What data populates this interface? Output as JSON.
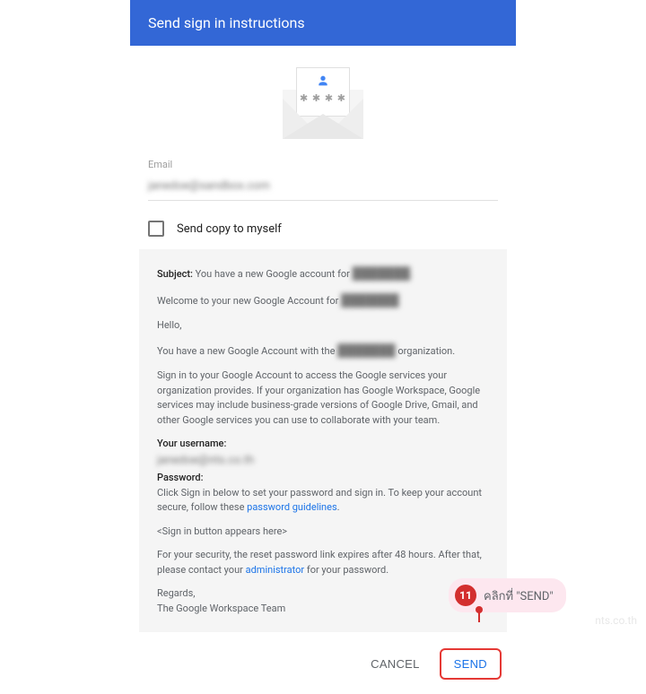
{
  "header": {
    "title": "Send sign in instructions"
  },
  "email": {
    "label": "Email",
    "value": "janedoe@sandbox.com"
  },
  "checkbox": {
    "label": "Send copy to myself"
  },
  "preview": {
    "subject_label": "Subject:",
    "subject": "You have a new Google account for",
    "subject_blur": "███████.",
    "welcome": "Welcome to your new Google Account for",
    "welcome_blur": "███████",
    "hello": "Hello,",
    "line1a": "You have a new Google Account with the",
    "line1_blur": "███████",
    "line1b": "organization.",
    "line2": "Sign in to your Google Account to access the Google services your organization provides. If your organization has Google Workspace, Google services may include business-grade versions of Google Drive, Gmail, and other Google services you can use to collaborate with your team.",
    "username_label": "Your username:",
    "username_blur": "janedoe@nts.co.th",
    "password_label": "Password:",
    "password_text": "Click Sign in below to set your password and sign in. To keep your account secure, follow these ",
    "password_link": "password guidelines",
    "signin_placeholder": "<Sign in button appears here>",
    "security": "For your security, the reset password link expires after 48 hours. After that, please contact your ",
    "admin_link": "administrator",
    "security_tail": " for your password.",
    "regards": "Regards,",
    "team": "The Google Workspace Team"
  },
  "actions": {
    "cancel": "CANCEL",
    "send": "SEND"
  },
  "annotation": {
    "num": "11",
    "text": "คลิกที่ \"SEND\""
  },
  "watermark": "nts.co.th"
}
